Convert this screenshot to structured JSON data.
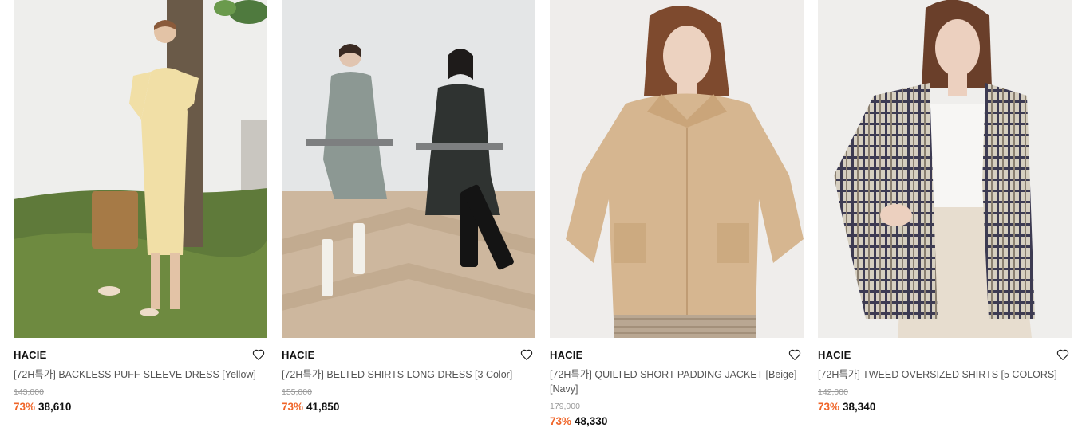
{
  "products": [
    {
      "brand": "HACIE",
      "title": "[72H특가] BACKLESS PUFF-SLEEVE DRESS [Yellow]",
      "original_price": "143,000",
      "discount": "73%",
      "price": "38,610"
    },
    {
      "brand": "HACIE",
      "title": "[72H특가] BELTED SHIRTS LONG DRESS [3 Color]",
      "original_price": "155,000",
      "discount": "73%",
      "price": "41,850"
    },
    {
      "brand": "HACIE",
      "title": "[72H특가] QUILTED SHORT PADDING JACKET [Beige] [Navy]",
      "original_price": "179,000",
      "discount": "73%",
      "price": "48,330"
    },
    {
      "brand": "HACIE",
      "title": "[72H특가] TWEED OVERSIZED SHIRTS [5 COLORS]",
      "original_price": "142,000",
      "discount": "73%",
      "price": "38,340"
    }
  ],
  "icons": {
    "wishlist": "heart-outline-icon"
  },
  "colors": {
    "discount": "#f0662a",
    "original_price": "#9a9a9a"
  }
}
